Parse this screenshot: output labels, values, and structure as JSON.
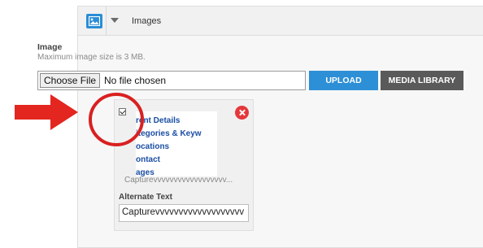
{
  "panel": {
    "header_title": "Images",
    "image_icon": "image-icon",
    "caret_icon": "caret-down-icon"
  },
  "image_field": {
    "label": "Image",
    "help_text": "Maximum image size is 3 MB.",
    "choose_file_label": "Choose File",
    "no_file_text": "No file chosen",
    "upload_label": "UPLOAD",
    "media_library_label": "MEDIA LIBRARY"
  },
  "image_card": {
    "checked": true,
    "thumbnail_items": [
      "rent Details",
      "itegories & Keyw",
      "ocations",
      "ontact",
      "ages"
    ],
    "filename": "Capturevvvvvvvvvvvvvvvvvv...",
    "alt_text_label": "Alternate Text",
    "alt_text_value": "Capturevvvvvvvvvvvvvvvvvvv",
    "remove_icon": "remove-icon"
  },
  "annotations": {
    "arrow_color": "#e3261f",
    "circle_color": "#d92020"
  },
  "colors": {
    "accent_blue": "#2d8fd6",
    "media_button": "#5a5a5a",
    "thumbnail_link": "#1a4ea3"
  }
}
